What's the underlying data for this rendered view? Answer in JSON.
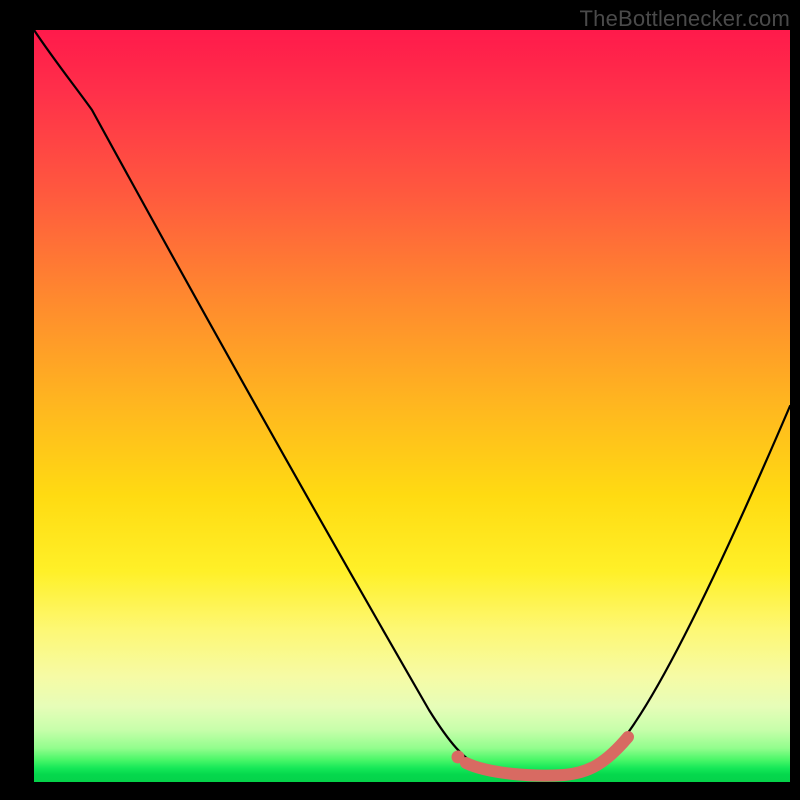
{
  "watermark": "TheBottlenecker.com",
  "colors": {
    "gradient_top": "#ff1a4b",
    "gradient_mid": "#ffdb12",
    "gradient_bottom": "#05d24a",
    "curve": "#000000",
    "highlight": "#d86a62",
    "frame": "#000000"
  },
  "chart_data": {
    "type": "line",
    "title": "",
    "xlabel": "",
    "ylabel": "",
    "xlim": [
      0,
      100
    ],
    "ylim": [
      0,
      100
    ],
    "notes": "No axis ticks or numeric labels are visible; values are estimated from pixel positions on a 0–100 normalized scale. y=0 is the bottom (green) edge; the curve is a V-shape with a flat minimum.",
    "series": [
      {
        "name": "bottleneck-curve",
        "x": [
          0,
          4,
          8,
          12,
          16,
          20,
          24,
          28,
          32,
          36,
          40,
          44,
          48,
          52,
          55,
          58,
          61,
          64,
          67,
          70,
          73,
          76,
          79,
          82,
          85,
          88,
          91,
          94,
          97,
          100
        ],
        "y": [
          100,
          94,
          88,
          81,
          74,
          67,
          60,
          53,
          46,
          39,
          32,
          25,
          18,
          11,
          6,
          3,
          1.4,
          0.8,
          0.6,
          0.6,
          0.9,
          1.8,
          4.5,
          9,
          15,
          22,
          29,
          36,
          43,
          50
        ]
      }
    ],
    "highlight_region": {
      "description": "Thick salmon segment along the flat bottom of the curve and lower right ascent.",
      "x_start": 57,
      "x_end": 79,
      "leading_dot_x": 56.2,
      "leading_dot_y": 3.3
    }
  }
}
